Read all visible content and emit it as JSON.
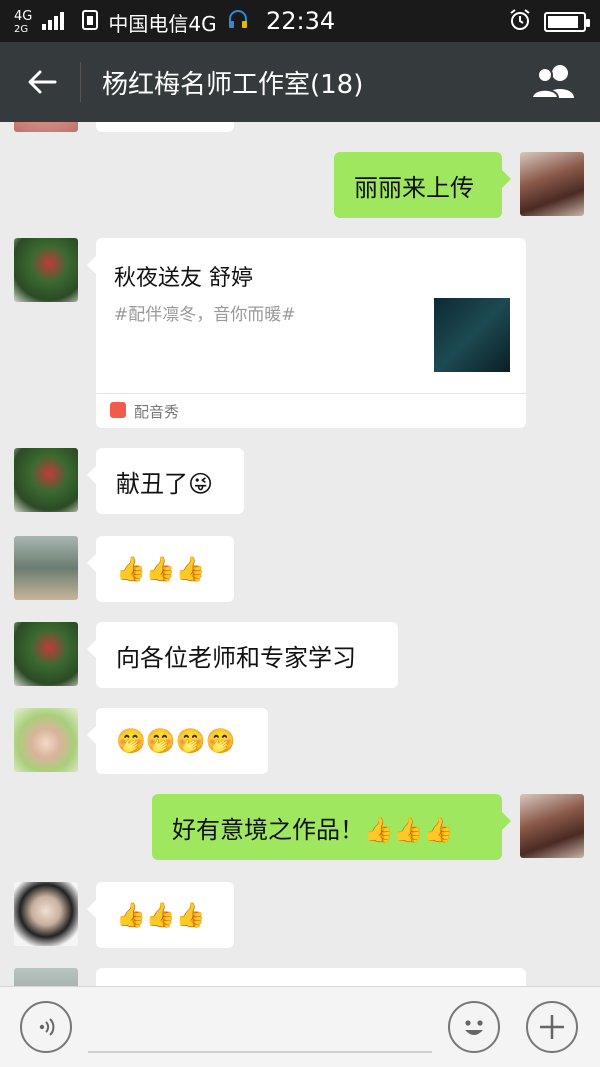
{
  "status_bar": {
    "net_top": "4G",
    "net_bottom": "2G",
    "signal_small_top": "4G",
    "signal_small_bottom": "2G",
    "carrier": "中国电信4G",
    "time": "22:34"
  },
  "header": {
    "title": "杨红梅名师工作室(18)"
  },
  "messages": {
    "m1": {
      "text": "丽丽来上传"
    },
    "m2": {
      "title": "秋夜送友 舒婷",
      "desc": "#配伴凛冬，音你而暖#",
      "source": "配音秀"
    },
    "m3": {
      "text": "献丑了😜"
    },
    "m4": {
      "text": "👍👍👍"
    },
    "m5": {
      "text": "向各位老师和专家学习"
    },
    "m6": {
      "text": "🤭🤭🤭🤭"
    },
    "m7": {
      "text": "好有意境之作品！👍👍👍"
    },
    "m8": {
      "text": "👍👍👍"
    }
  },
  "colors": {
    "header_bg": "#353b3d",
    "chat_bg": "#ebebeb",
    "self_bubble": "#9ee75f"
  },
  "icons": [
    "back-arrow-icon",
    "group-members-icon",
    "voice-input-icon",
    "emoji-icon",
    "add-icon"
  ]
}
